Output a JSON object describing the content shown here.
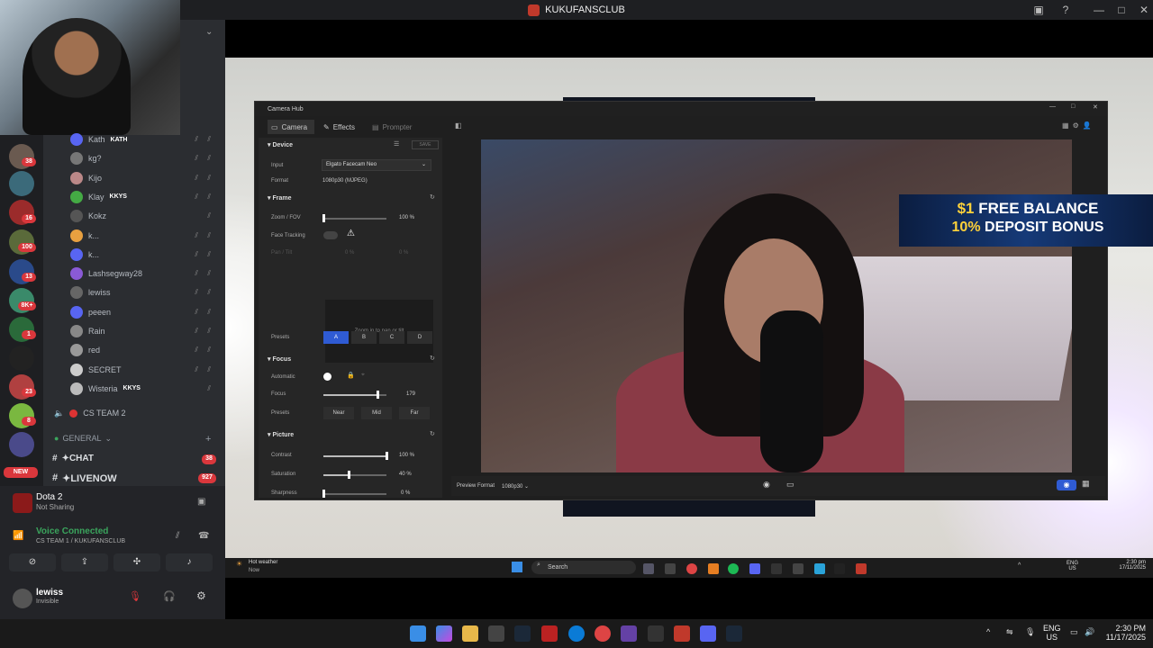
{
  "window": {
    "title": "KUKUFANSCLUB"
  },
  "discord": {
    "members": [
      {
        "name": "Kath",
        "tag": "KATH"
      },
      {
        "name": "kg?"
      },
      {
        "name": "Kijo"
      },
      {
        "name": "Klay",
        "tag": "KKYS"
      },
      {
        "name": "Kokz"
      },
      {
        "name": "k..."
      },
      {
        "name": "k..."
      },
      {
        "name": "Lashsegway28"
      },
      {
        "name": "lewiss"
      },
      {
        "name": "peeen"
      },
      {
        "name": "Rain"
      },
      {
        "name": "red"
      },
      {
        "name": "SECRET"
      },
      {
        "name": "Wisteria",
        "tag": "KKYS"
      }
    ],
    "voice_channel": "CS TEAM 2",
    "category": "GENERAL",
    "channels": [
      {
        "name": "✦CHAT",
        "badge": "38"
      },
      {
        "name": "✦LIVENOW",
        "badge": "927"
      }
    ],
    "server_badges": [
      "38",
      "16",
      "100",
      "13",
      "8K+",
      "1",
      "23",
      "8"
    ],
    "new_badge": "NEW",
    "activity": {
      "title": "Dota 2",
      "subtitle": "Not Sharing"
    },
    "voice": {
      "status": "Voice Connected",
      "channel": "CS TEAM 1 / KUKUFANSCLUB"
    },
    "user": {
      "name": "lewiss",
      "status": "Invisible"
    }
  },
  "camhub": {
    "title": "Camera Hub",
    "tabs": [
      "Camera",
      "Effects",
      "Prompter"
    ],
    "device": {
      "header": "Device",
      "save": "SAVE",
      "input_label": "Input",
      "input_value": "Elgato Facecam Neo",
      "format_label": "Format",
      "format_value": "1080p30 (MJPEG)"
    },
    "frame": {
      "header": "Frame",
      "zoom_label": "Zoom / FOV",
      "zoom_value": "100 %",
      "zoom": 0,
      "tracking_label": "Face Tracking",
      "pantilt_label": "Pan / Tilt",
      "pan_value": "0 %",
      "tilt_value": "0 %",
      "pan_hint": "Zoom in to pan or tilt",
      "presets_label": "Presets",
      "presets": [
        "A",
        "B",
        "C",
        "D"
      ]
    },
    "focus": {
      "header": "Focus",
      "auto_label": "Automatic",
      "focus_label": "Focus",
      "focus_value": "179",
      "focus": 0.85,
      "presets_label": "Presets",
      "presets": [
        "Near",
        "Mid",
        "Far"
      ]
    },
    "picture": {
      "header": "Picture",
      "contrast_label": "Contrast",
      "contrast_value": "100 %",
      "contrast": 1.0,
      "saturation_label": "Saturation",
      "saturation_value": "40 %",
      "saturation": 0.4,
      "sharpness_label": "Sharpness",
      "sharpness_value": "0 %",
      "sharpness": 0
    },
    "preview_format_label": "Preview Format",
    "preview_format_value": "1080p30"
  },
  "promo": {
    "line1_a": "$1",
    "line1_b": " FREE BALANCE",
    "line2_a": "10%",
    "line2_b": " DEPOSIT BONUS"
  },
  "inner_taskbar": {
    "weather": "Hot weather",
    "weather_sub": "Now",
    "search": "Search",
    "lang1": "ENG",
    "lang2": "US",
    "time": "2:30 pm",
    "date": "17/11/2025"
  },
  "win_taskbar": {
    "lang1": "ENG",
    "lang2": "US",
    "time": "2:30 PM",
    "date": "11/17/2025"
  }
}
